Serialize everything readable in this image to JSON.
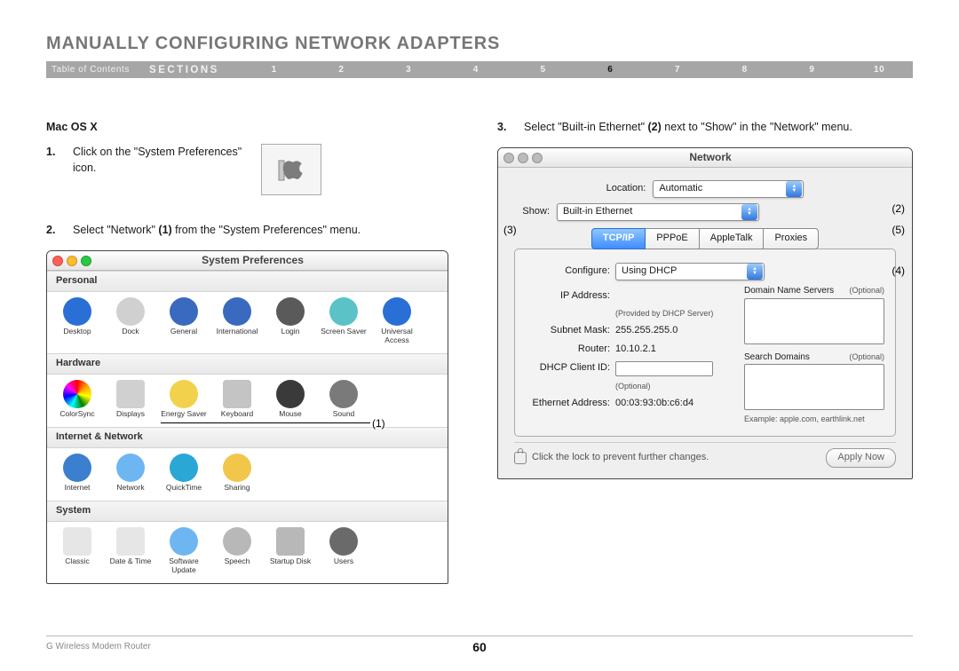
{
  "title": "MANUALLY CONFIGURING NETWORK ADAPTERS",
  "nav": {
    "toc": "Table of Contents",
    "sections": "SECTIONS",
    "items": [
      "1",
      "2",
      "3",
      "4",
      "5",
      "6",
      "7",
      "8",
      "9",
      "10"
    ],
    "active_index": 5
  },
  "os_heading": "Mac OS X",
  "step1_num": "1.",
  "step1_text": "Click on the \"System Preferences\" icon.",
  "step2_num": "2.",
  "step2_pre": "Select \"Network\" ",
  "step2_bold": "(1)",
  "step2_post": " from the \"System Preferences\" menu.",
  "step3_num": "3.",
  "step3_pre": "Select \"Built-in Ethernet\" ",
  "step3_bold": "(2)",
  "step3_post": " next to \"Show\" in the \"Network\" menu.",
  "sysprefs": {
    "title": "System Preferences",
    "sections": [
      {
        "heading": "Personal",
        "items": [
          {
            "label": "Desktop",
            "color": "#2a6fd6"
          },
          {
            "label": "Dock",
            "color": "#d0d0d0"
          },
          {
            "label": "General",
            "color": "#3a6abf"
          },
          {
            "label": "International",
            "color": "#3a6abf"
          },
          {
            "label": "Login",
            "color": "#5a5a5a"
          },
          {
            "label": "Screen Saver",
            "color": "#5bc2c7"
          },
          {
            "label": "Universal Access",
            "color": "#2a6fd6"
          }
        ]
      },
      {
        "heading": "Hardware",
        "items": [
          {
            "label": "ColorSync",
            "color": "conic"
          },
          {
            "label": "Displays",
            "color": "#d0d0d0"
          },
          {
            "label": "Energy Saver",
            "color": "#f2d24d"
          },
          {
            "label": "Keyboard",
            "color": "#c4c4c4"
          },
          {
            "label": "Mouse",
            "color": "#3a3a3a"
          },
          {
            "label": "Sound",
            "color": "#7a7a7a"
          }
        ]
      },
      {
        "heading": "Internet & Network",
        "items": [
          {
            "label": "Internet",
            "color": "#3b7fce"
          },
          {
            "label": "Network",
            "color": "#6eb6f2"
          },
          {
            "label": "QuickTime",
            "color": "#2aa7d4"
          },
          {
            "label": "Sharing",
            "color": "#f1c64b"
          }
        ]
      },
      {
        "heading": "System",
        "items": [
          {
            "label": "Classic",
            "color": "#e6e6e6"
          },
          {
            "label": "Date & Time",
            "color": "#e6e6e6"
          },
          {
            "label": "Software Update",
            "color": "#6eb6f2"
          },
          {
            "label": "Speech",
            "color": "#b8b8b8"
          },
          {
            "label": "Startup Disk",
            "color": "#b8b8b8"
          },
          {
            "label": "Users",
            "color": "#6a6a6a"
          }
        ]
      }
    ]
  },
  "callout_sp": "(1)",
  "network": {
    "title": "Network",
    "location_label": "Location:",
    "location_value": "Automatic",
    "show_label": "Show:",
    "show_value": "Built-in Ethernet",
    "tabs": [
      "TCP/IP",
      "PPPoE",
      "AppleTalk",
      "Proxies"
    ],
    "active_tab": 0,
    "configure_label": "Configure:",
    "configure_value": "Using DHCP",
    "dns_label": "Domain Name Servers",
    "optional": "(Optional)",
    "ip_label": "IP Address:",
    "ip_note": "(Provided by DHCP Server)",
    "subnet_label": "Subnet Mask:",
    "subnet_value": "255.255.255.0",
    "router_label": "Router:",
    "router_value": "10.10.2.1",
    "search_label": "Search Domains",
    "dhcp_label": "DHCP Client ID:",
    "dhcp_note": "(Optional)",
    "eth_label": "Ethernet Address:",
    "eth_value": "00:03:93:0b:c6:d4",
    "example": "Example: apple.com, earthlink.net",
    "lock_text": "Click the lock to prevent further changes.",
    "apply": "Apply Now"
  },
  "callouts": {
    "c2": "(2)",
    "c3": "(3)",
    "c4": "(4)",
    "c5": "(5)"
  },
  "footer": {
    "product": "G Wireless Modem Router",
    "page": "60"
  }
}
